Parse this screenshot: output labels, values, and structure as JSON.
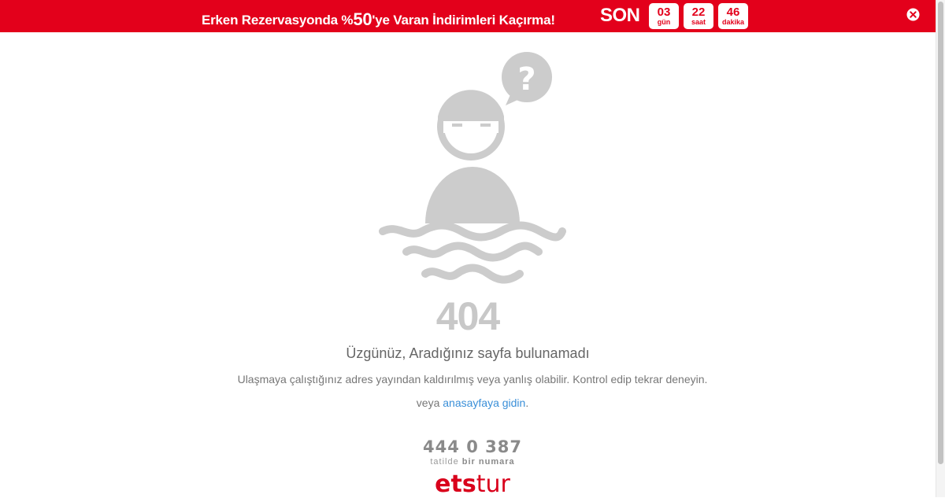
{
  "banner": {
    "text_before": "Erken Rezervasyonda %",
    "text_big": "50",
    "text_after": "'ye Varan İndirimleri Kaçırma!",
    "son_label": "SON",
    "countdown": [
      {
        "value": "03",
        "unit": "gün"
      },
      {
        "value": "22",
        "unit": "saat"
      },
      {
        "value": "46",
        "unit": "dakika"
      }
    ],
    "close_icon": "close-icon"
  },
  "error": {
    "illustration_icon": "drowning-person-icon",
    "code": "404",
    "title": "Üzgünüz, Aradığınız sayfa bulunamadı",
    "description": "Ulaşmaya çalıştığınız adres yayından kaldırılmış veya yanlış olabilir. Kontrol edip tekrar deneyin.",
    "home_prefix": "veya ",
    "home_link": "anasayfaya gidin",
    "home_suffix": "."
  },
  "footer": {
    "phone": "444 0 387",
    "slogan_light": "tatilde ",
    "slogan_bold": "bir numara",
    "brand_bold": "ets",
    "brand_light": "tur"
  },
  "colors": {
    "brand_red": "#e3001b",
    "illustration_gray": "#cccccc",
    "link_blue": "#3a8fd8"
  }
}
